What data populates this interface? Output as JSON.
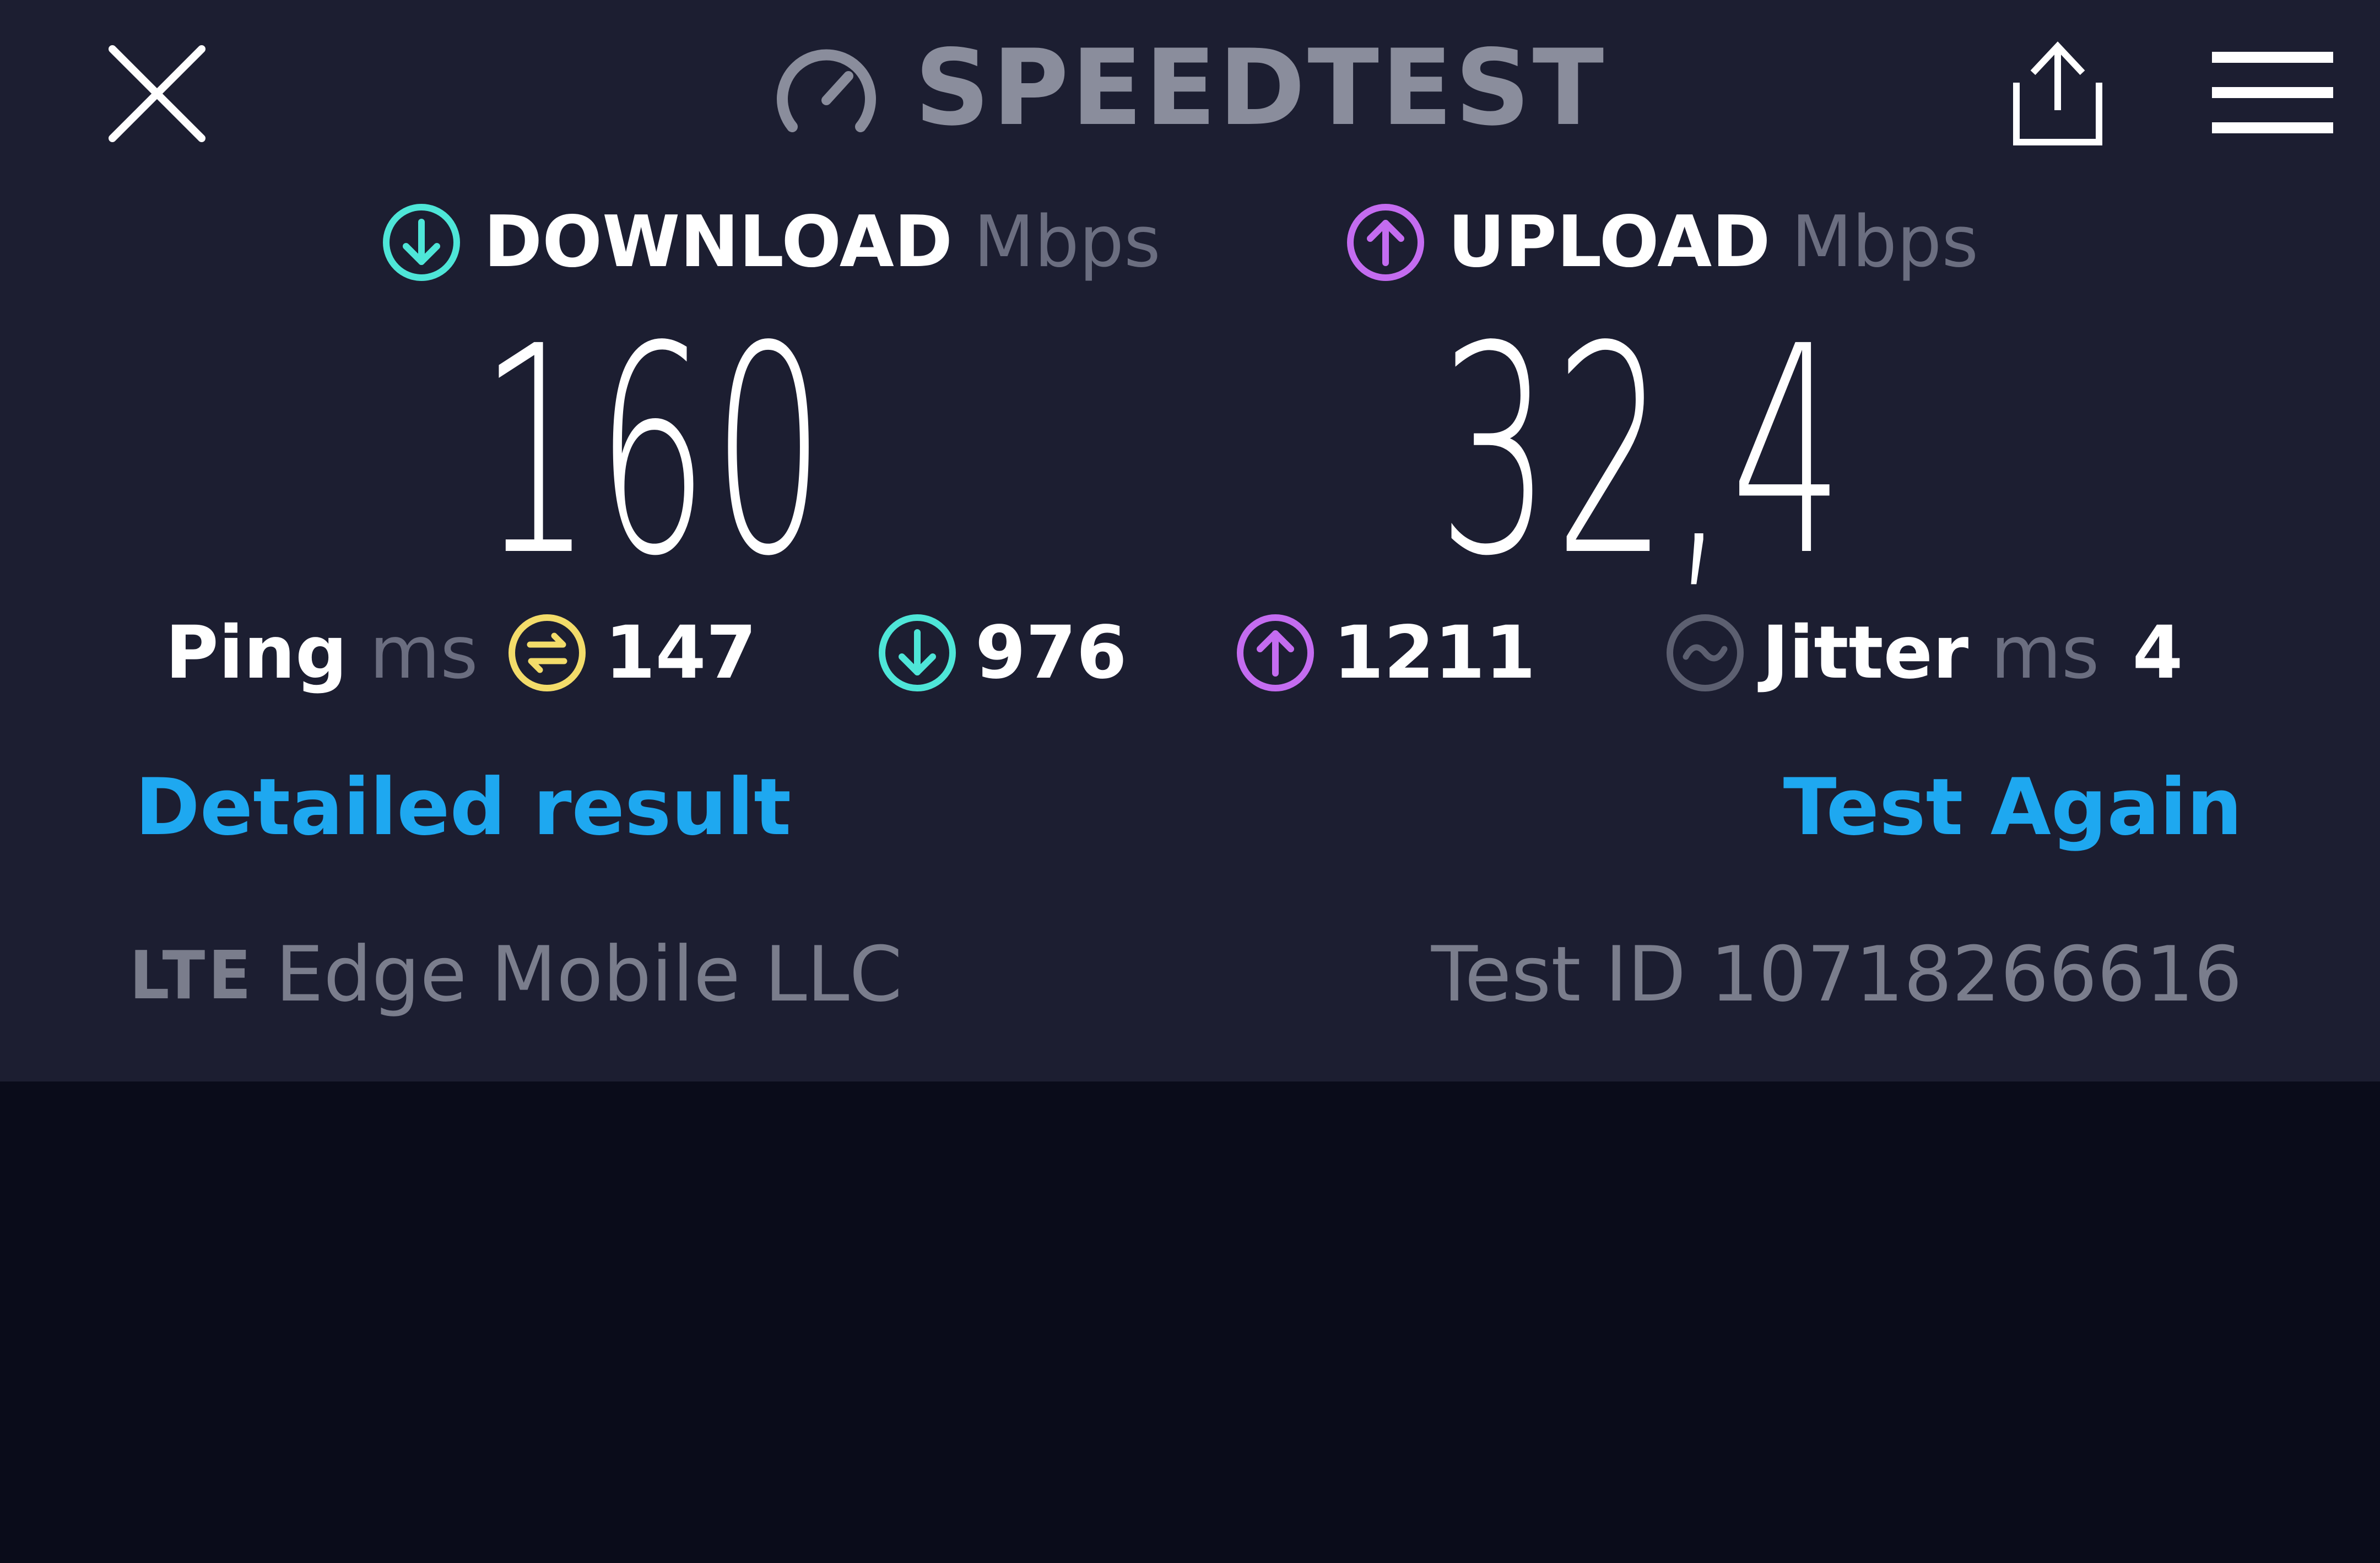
{
  "header": {
    "brand": "SPEEDTEST",
    "close_icon": "close-icon",
    "share_icon": "share-icon",
    "menu_icon": "hamburger-menu-icon"
  },
  "download": {
    "label": "DOWNLOAD",
    "unit": "Mbps",
    "value": "160",
    "icon": "download-arrow-icon",
    "color": "#4ee6d8"
  },
  "upload": {
    "label": "UPLOAD",
    "unit": "Mbps",
    "value": "32,4",
    "icon": "upload-arrow-icon",
    "color": "#c46cf0"
  },
  "stats": {
    "ping": {
      "label": "Ping",
      "unit": "ms",
      "value": "147",
      "icon": "ping-icon",
      "color": "#f3dc6a"
    },
    "download_latency": {
      "value": "976",
      "icon": "download-arrow-icon"
    },
    "upload_latency": {
      "value": "1211",
      "icon": "upload-arrow-icon"
    },
    "jitter": {
      "label": "Jitter",
      "unit": "ms",
      "value": "4",
      "icon": "jitter-icon",
      "color": "#5c5f70"
    }
  },
  "links": {
    "detailed": "Detailed result",
    "again": "Test Again",
    "color": "#1ea8f0"
  },
  "footer": {
    "network_type": "LTE",
    "provider": "Edge Mobile LLC",
    "test_id": "Test ID 10718266616"
  },
  "colors": {
    "panel": "#1c1e31",
    "background": "#0a0c1a",
    "muted": "#7a7d8c"
  }
}
